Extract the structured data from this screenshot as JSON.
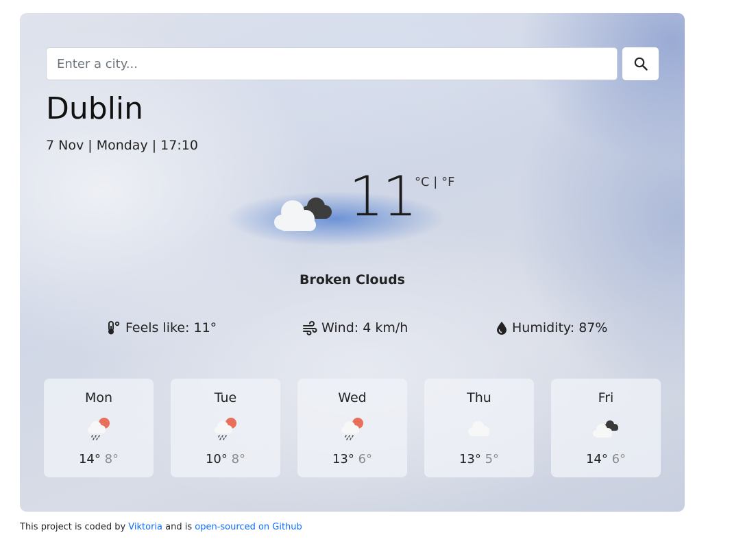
{
  "search": {
    "placeholder": "Enter a city...",
    "button_icon": "search-icon"
  },
  "current": {
    "city": "Dublin",
    "date": "7 Nov | Monday | 17:10",
    "temperature": "11",
    "unit_celsius": "°C",
    "unit_separator": " | ",
    "unit_fahrenheit": "°F",
    "description": "Broken Clouds",
    "icon": "broken-clouds-icon"
  },
  "stats": {
    "feels_like": "Feels like: 11°",
    "wind": "Wind: 4 km/h",
    "humidity": "Humidity: 87%"
  },
  "forecast": [
    {
      "day": "Mon",
      "max": "14°",
      "min": "8°",
      "icon": "rain-sun-icon"
    },
    {
      "day": "Tue",
      "max": "10°",
      "min": "8°",
      "icon": "rain-sun-icon"
    },
    {
      "day": "Wed",
      "max": "13°",
      "min": "6°",
      "icon": "rain-sun-icon"
    },
    {
      "day": "Thu",
      "max": "13°",
      "min": "5°",
      "icon": "cloud-icon"
    },
    {
      "day": "Fri",
      "max": "14°",
      "min": "6°",
      "icon": "broken-clouds-icon"
    }
  ],
  "footer": {
    "prefix": "This project is coded by ",
    "author": "Viktoria",
    "middle": " and is ",
    "link": "open-sourced on Github"
  },
  "colors": {
    "link": "#0d6efd",
    "sun": "#e8705a",
    "dark_cloud": "#3a3a3a"
  }
}
